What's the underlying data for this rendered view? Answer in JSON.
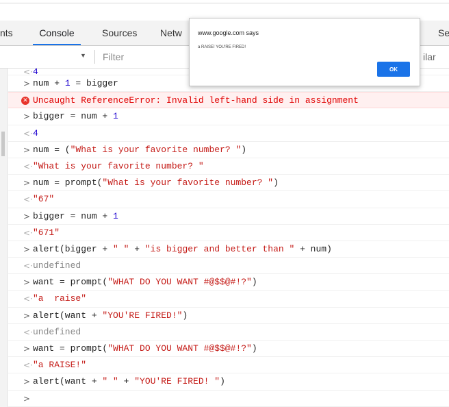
{
  "tabs": {
    "elements_partial": "nts",
    "console": "Console",
    "sources": "Sources",
    "network_partial": "Netw",
    "security_partial": "Se"
  },
  "filterbar": {
    "filter_placeholder": "Filter",
    "context_arrow": "▼",
    "similar_partial": "ilar"
  },
  "dialog": {
    "title": "www.google.com says",
    "message": "a RAISE! YOU'RE FIRED!",
    "ok_label": "OK"
  },
  "console": {
    "input_prompt": ">",
    "result_prompt": "<·",
    "rows": [
      {
        "kind": "result",
        "text": "4"
      },
      {
        "kind": "input",
        "text": "num + 1 = bigger"
      },
      {
        "kind": "error",
        "text": "Uncaught ReferenceError: Invalid left-hand side in assignment"
      },
      {
        "kind": "input",
        "text": "bigger = num + 1"
      },
      {
        "kind": "result",
        "text": "4"
      },
      {
        "kind": "input",
        "text": "num = (\"What is your favorite number? \")"
      },
      {
        "kind": "result",
        "text": "\"What is your favorite number? \""
      },
      {
        "kind": "input",
        "text": "num = prompt(\"What is your favorite number? \")"
      },
      {
        "kind": "result",
        "text": "\"67\""
      },
      {
        "kind": "input",
        "text": "bigger = num + 1"
      },
      {
        "kind": "result",
        "text": "\"671\""
      },
      {
        "kind": "input",
        "text": "alert(bigger + \" \" + \"is bigger and better than \" + num)"
      },
      {
        "kind": "result",
        "text": "undefined"
      },
      {
        "kind": "input",
        "text": "want = prompt(\"WHAT DO YOU WANT #@$$@#!?\")"
      },
      {
        "kind": "result",
        "text": "\"a  raise\""
      },
      {
        "kind": "input",
        "text": "alert(want + \"YOU'RE FIRED!\")"
      },
      {
        "kind": "result",
        "text": "undefined"
      },
      {
        "kind": "input",
        "text": "want = prompt(\"WHAT DO YOU WANT #@$$@#!?\")"
      },
      {
        "kind": "result",
        "text": "\"a RAISE!\""
      },
      {
        "kind": "input",
        "text": "alert(want + \" \" + \"YOU'RE FIRED! \")"
      },
      {
        "kind": "prompt",
        "text": ""
      }
    ]
  },
  "colors": {
    "active_tab_underline": "#1a73e8",
    "string": "#c41a16",
    "number": "#1c00cf",
    "error_text": "#e00000",
    "error_bg": "#fff0f0",
    "ok_button": "#1a73e8"
  },
  "icons": {
    "error": "error-circle-icon",
    "context_dropdown": "triangle-down-icon"
  }
}
